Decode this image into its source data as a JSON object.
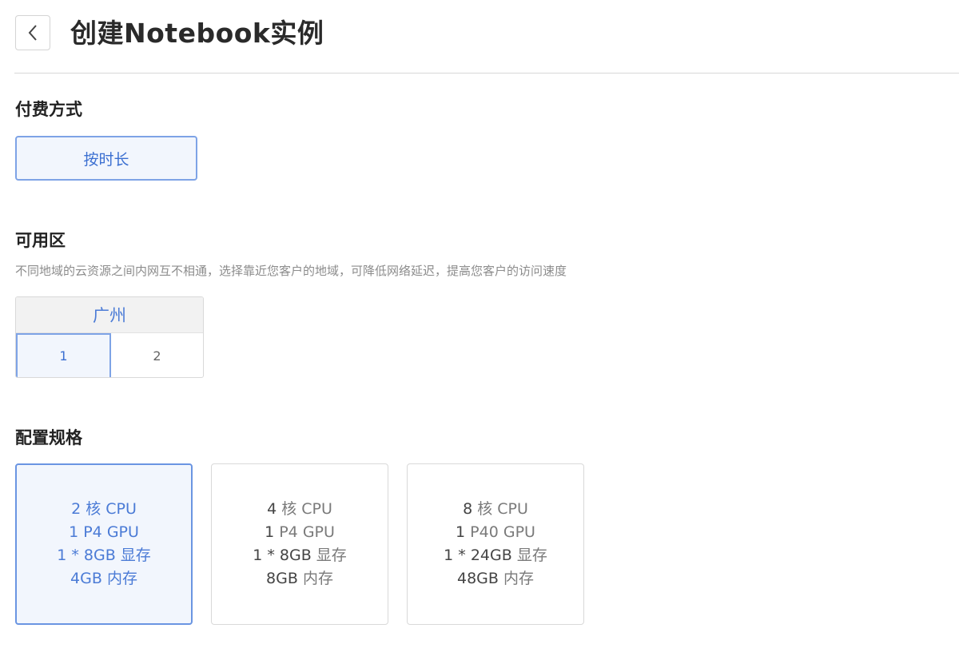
{
  "header": {
    "title": "创建Notebook实例",
    "back_icon": "chevron-left-icon"
  },
  "payment": {
    "title": "付费方式",
    "options": [
      {
        "label": "按时长",
        "selected": true
      }
    ]
  },
  "availability_zone": {
    "title": "可用区",
    "hint": "不同地域的云资源之间内网互不相通，选择靠近您客户的地域，可降低网络延迟，提高您客户的访问速度",
    "region": "广州",
    "zones": [
      {
        "label": "1",
        "selected": true
      },
      {
        "label": "2",
        "selected": false
      }
    ]
  },
  "specs": {
    "title": "配置规格",
    "cards": [
      {
        "selected": true,
        "cpu_num": "2",
        "cpu_unit": " 核 CPU",
        "gpu_num": "1",
        "gpu_unit": " P4 GPU",
        "vram_num": "1 * 8GB",
        "vram_unit": " 显存",
        "mem_num": "4GB",
        "mem_unit": " 内存"
      },
      {
        "selected": false,
        "cpu_num": "4",
        "cpu_unit": " 核 CPU",
        "gpu_num": "1",
        "gpu_unit": " P4 GPU",
        "vram_num": "1 * 8GB",
        "vram_unit": " 显存",
        "mem_num": "8GB",
        "mem_unit": " 内存"
      },
      {
        "selected": false,
        "cpu_num": "8",
        "cpu_unit": " 核 CPU",
        "gpu_num": "1",
        "gpu_unit": " P40 GPU",
        "vram_num": "1 * 24GB",
        "vram_unit": " 显存",
        "mem_num": "48GB",
        "mem_unit": " 内存"
      }
    ]
  },
  "colors": {
    "accent": "#3b6fd1",
    "selected_bg": "#f2f6fd",
    "selected_border": "#7ea3e6"
  }
}
